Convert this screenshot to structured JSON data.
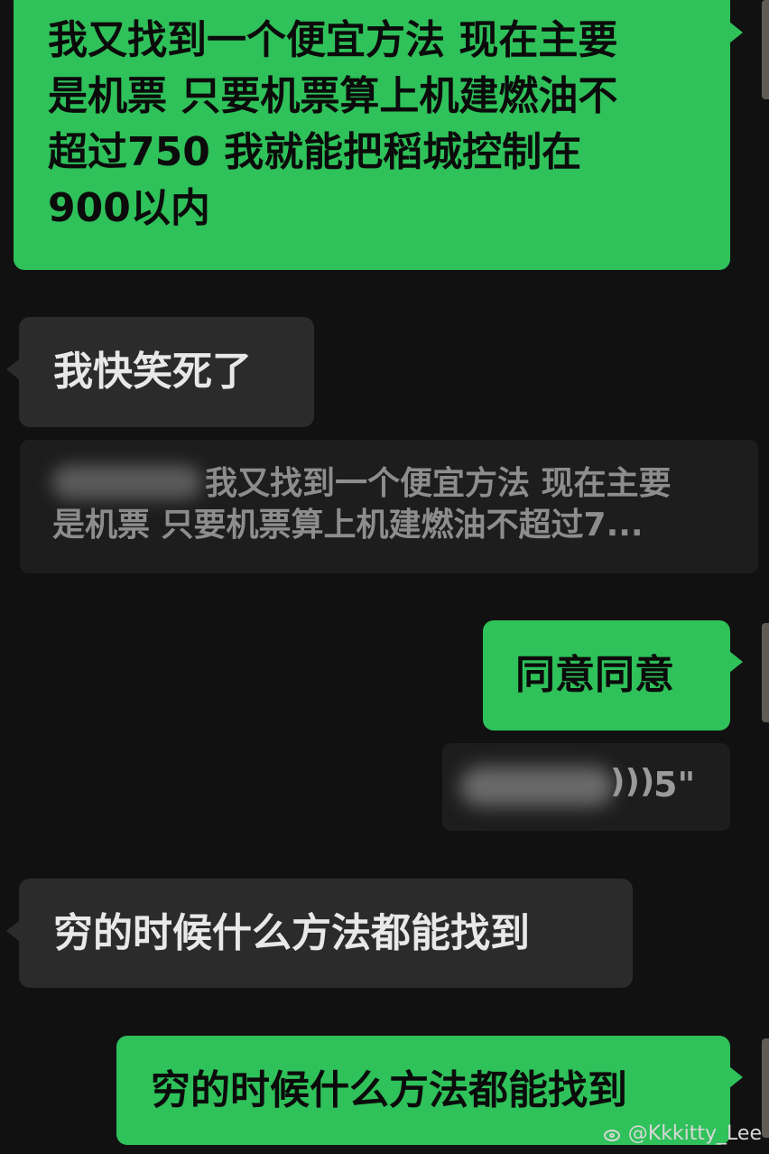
{
  "messages": [
    {
      "direction": "outgoing",
      "text": "我又找到一个便宜方法 现在主要是机票 只要机票算上机建燃油不超过750 我就能把稻城控制在900以内",
      "lines": [
        "我又找到一个便宜方法 现在主要",
        "是机票 只要机票算上机建燃油不",
        "超过750 我就能把稻城控制在",
        "900以内"
      ]
    },
    {
      "direction": "incoming",
      "text": "我快笑死了"
    },
    {
      "type": "quote",
      "line1": "我又找到一个便宜方法 现在主要",
      "line2": "是机票 只要机票算上机建燃油不超过7..."
    },
    {
      "direction": "outgoing",
      "text": "同意同意"
    },
    {
      "type": "voice-quote",
      "duration": "5\""
    },
    {
      "direction": "incoming",
      "text": "穷的时候什么方法都能找到"
    },
    {
      "direction": "outgoing",
      "text": "穷的时候什么方法都能找到"
    }
  ],
  "watermark": {
    "text": "@Kkkitty_Lee",
    "icon": "weibo-icon"
  },
  "colors": {
    "background": "#111111",
    "outgoing_bubble": "#2fc15a",
    "incoming_bubble": "#2b2b2b",
    "quote_background": "#1d1d1d"
  }
}
